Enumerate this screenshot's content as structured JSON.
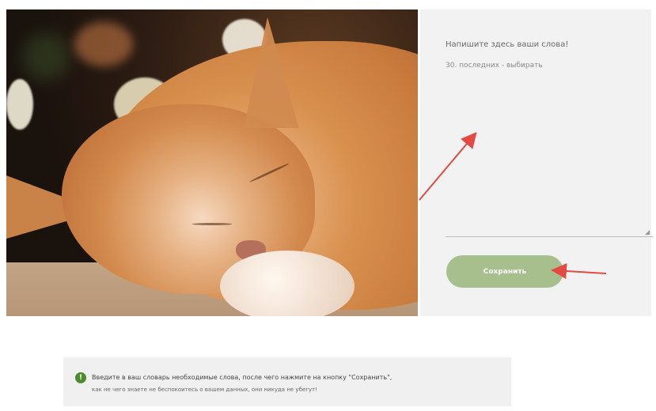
{
  "form": {
    "title": "Напишите здесь ваши слова!",
    "subtitle": "30. последних - выбирать",
    "textarea_value": "",
    "save_label": "Сохранить"
  },
  "notice": {
    "icon": "info-icon",
    "line1": "Введите в ваш словарь необходимые слова, после чего нажмите на кнопку \"Сохранить\",",
    "line2": "как не чего знаете не беспокоитесь о вашем данных, они никуда не убегут!"
  },
  "colors": {
    "panel_bg": "#f2f2f2",
    "save_button": "#a7bf8d",
    "arrow": "#e24a42",
    "info_icon": "#4e8a2e"
  },
  "image": {
    "subject": "sleeping-orange-cat-photo"
  }
}
